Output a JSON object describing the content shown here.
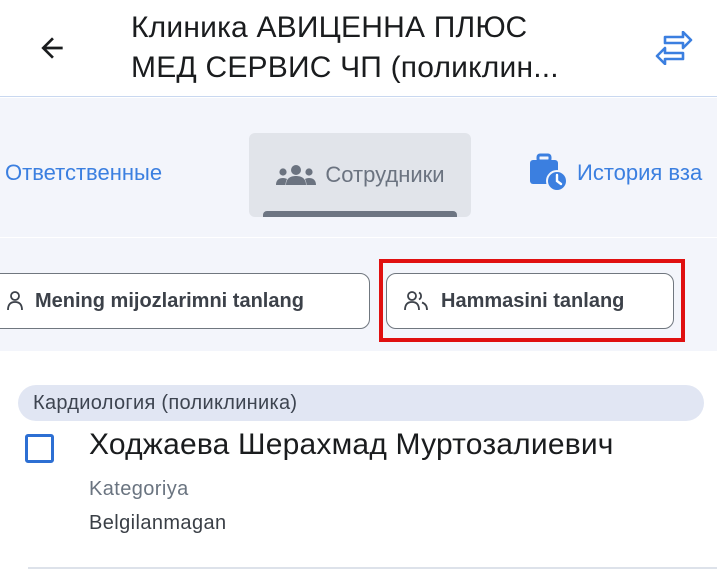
{
  "header": {
    "title_line1": "Клиника АВИЦЕННА ПЛЮС",
    "title_line2": "МЕД СЕРВИС ЧП (поликлин..."
  },
  "tabs": [
    {
      "label": "Ответственные",
      "icon": "person-icon"
    },
    {
      "label": "Сотрудники",
      "icon": "group-icon",
      "selected": true
    },
    {
      "label": "История вза",
      "icon": "briefcase-clock-icon"
    }
  ],
  "filters": {
    "my_clients_label": "Mening mijozlarimni tanlang",
    "select_all_label": "Hammasini tanlang"
  },
  "employees": {
    "group": "Кардиология (поликлиника)",
    "items": [
      {
        "name": "Ходжаева Шерахмад Муртозалиевич",
        "category_label": "Kategoriya",
        "category_value": "Belgilanmagan",
        "checked": false
      }
    ]
  },
  "colors": {
    "accent": "#3b7fe0",
    "highlight": "#e01010",
    "checkbox": "#2d6fd3"
  }
}
